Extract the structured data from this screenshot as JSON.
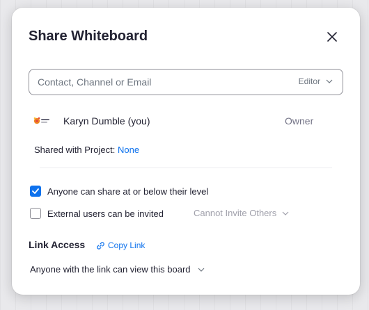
{
  "dialog": {
    "title": "Share Whiteboard",
    "close_icon": "close-icon"
  },
  "invite": {
    "placeholder": "Contact, Channel or Email",
    "value": "",
    "role": "Editor"
  },
  "members": [
    {
      "name": "Karyn Dumble (you)",
      "role": "Owner",
      "avatar_icon": "logo-avatar"
    }
  ],
  "project": {
    "label": "Shared with Project:",
    "value": "None"
  },
  "permissions": {
    "anyone_share": {
      "label": "Anyone can share at or below their level",
      "checked": true
    },
    "external_invite": {
      "label": "External users can be invited",
      "checked": false
    },
    "external_option": "Cannot Invite Others"
  },
  "link_access": {
    "title": "Link Access",
    "copy_label": "Copy Link",
    "setting": "Anyone with the link can view this board"
  },
  "colors": {
    "accent": "#0e72ed",
    "text": "#232333",
    "muted": "#747487"
  }
}
